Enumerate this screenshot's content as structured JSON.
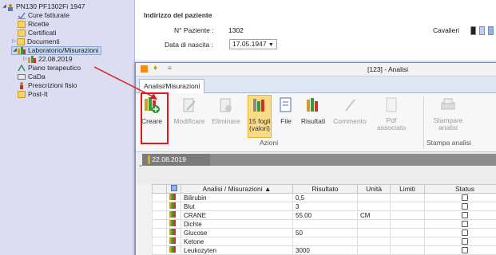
{
  "tree": {
    "root": "PN130 PF1302Fi 1947",
    "items": [
      {
        "label": "Cure fatturate",
        "icon": "checklist-icon"
      },
      {
        "label": "Ricette",
        "icon": "folder-icon"
      },
      {
        "label": "Certificati",
        "icon": "folder-icon"
      },
      {
        "label": "Documenti",
        "icon": "folder-icon"
      },
      {
        "label": "Laboratorio/Misurazioni",
        "icon": "lab-bottles-icon"
      },
      {
        "label": "22.08.2019",
        "icon": "lab-bottles-icon"
      },
      {
        "label": "Piano terapeutico",
        "icon": "plan-icon"
      },
      {
        "label": "CaDa",
        "icon": "card-icon"
      },
      {
        "label": "Prescrizioni fisio",
        "icon": "person-icon"
      },
      {
        "label": "Post-It",
        "icon": "folder-icon"
      }
    ]
  },
  "patient": {
    "section_title": "Indirizzo del paziente",
    "num_label": "N° Paziente :",
    "num_value": "1302",
    "dob_label": "Data di nascita :",
    "dob_value": "17.05.1947",
    "surname": "Cavalieri"
  },
  "dialog": {
    "title": "[123] - Analisi",
    "tab": "Analisi/Misurazioni",
    "ribbon": {
      "buttons": [
        {
          "label": "Creare",
          "enabled": true
        },
        {
          "label": "Modificare",
          "enabled": false
        },
        {
          "label": "Eliminare",
          "enabled": false
        },
        {
          "label": "15 fogli\n(valori)",
          "enabled": true,
          "active": true
        },
        {
          "label": "File",
          "enabled": true
        },
        {
          "label": "Risultati",
          "enabled": true
        },
        {
          "label": "Commento",
          "enabled": false
        },
        {
          "label": "Pdf\nassociato",
          "enabled": false
        },
        {
          "label": "Stampare\nanalisi",
          "enabled": false
        }
      ],
      "group_azioni": "Azioni",
      "group_stampa": "Stampa analisi"
    },
    "date_group": "22.08.2019",
    "grid": {
      "columns": [
        "Analisi / Misurazioni",
        "Risultato",
        "Unità",
        "Limiti",
        "Status"
      ],
      "rows": [
        {
          "name": "Bilirubin",
          "result": "0,5",
          "unit": "",
          "limits": ""
        },
        {
          "name": "Blut",
          "result": "3",
          "unit": "",
          "limits": ""
        },
        {
          "name": "CRANE",
          "result": "55.00",
          "unit": "CM",
          "limits": ""
        },
        {
          "name": "Dichte",
          "result": "",
          "unit": "",
          "limits": ""
        },
        {
          "name": "Glucose",
          "result": "50",
          "unit": "",
          "limits": ""
        },
        {
          "name": "Ketone",
          "result": "",
          "unit": "",
          "limits": ""
        },
        {
          "name": "Leukozyten",
          "result": "3000",
          "unit": "",
          "limits": ""
        }
      ]
    }
  },
  "colors": {
    "highlight": "#e01818",
    "active_button": "#fbdc86"
  }
}
